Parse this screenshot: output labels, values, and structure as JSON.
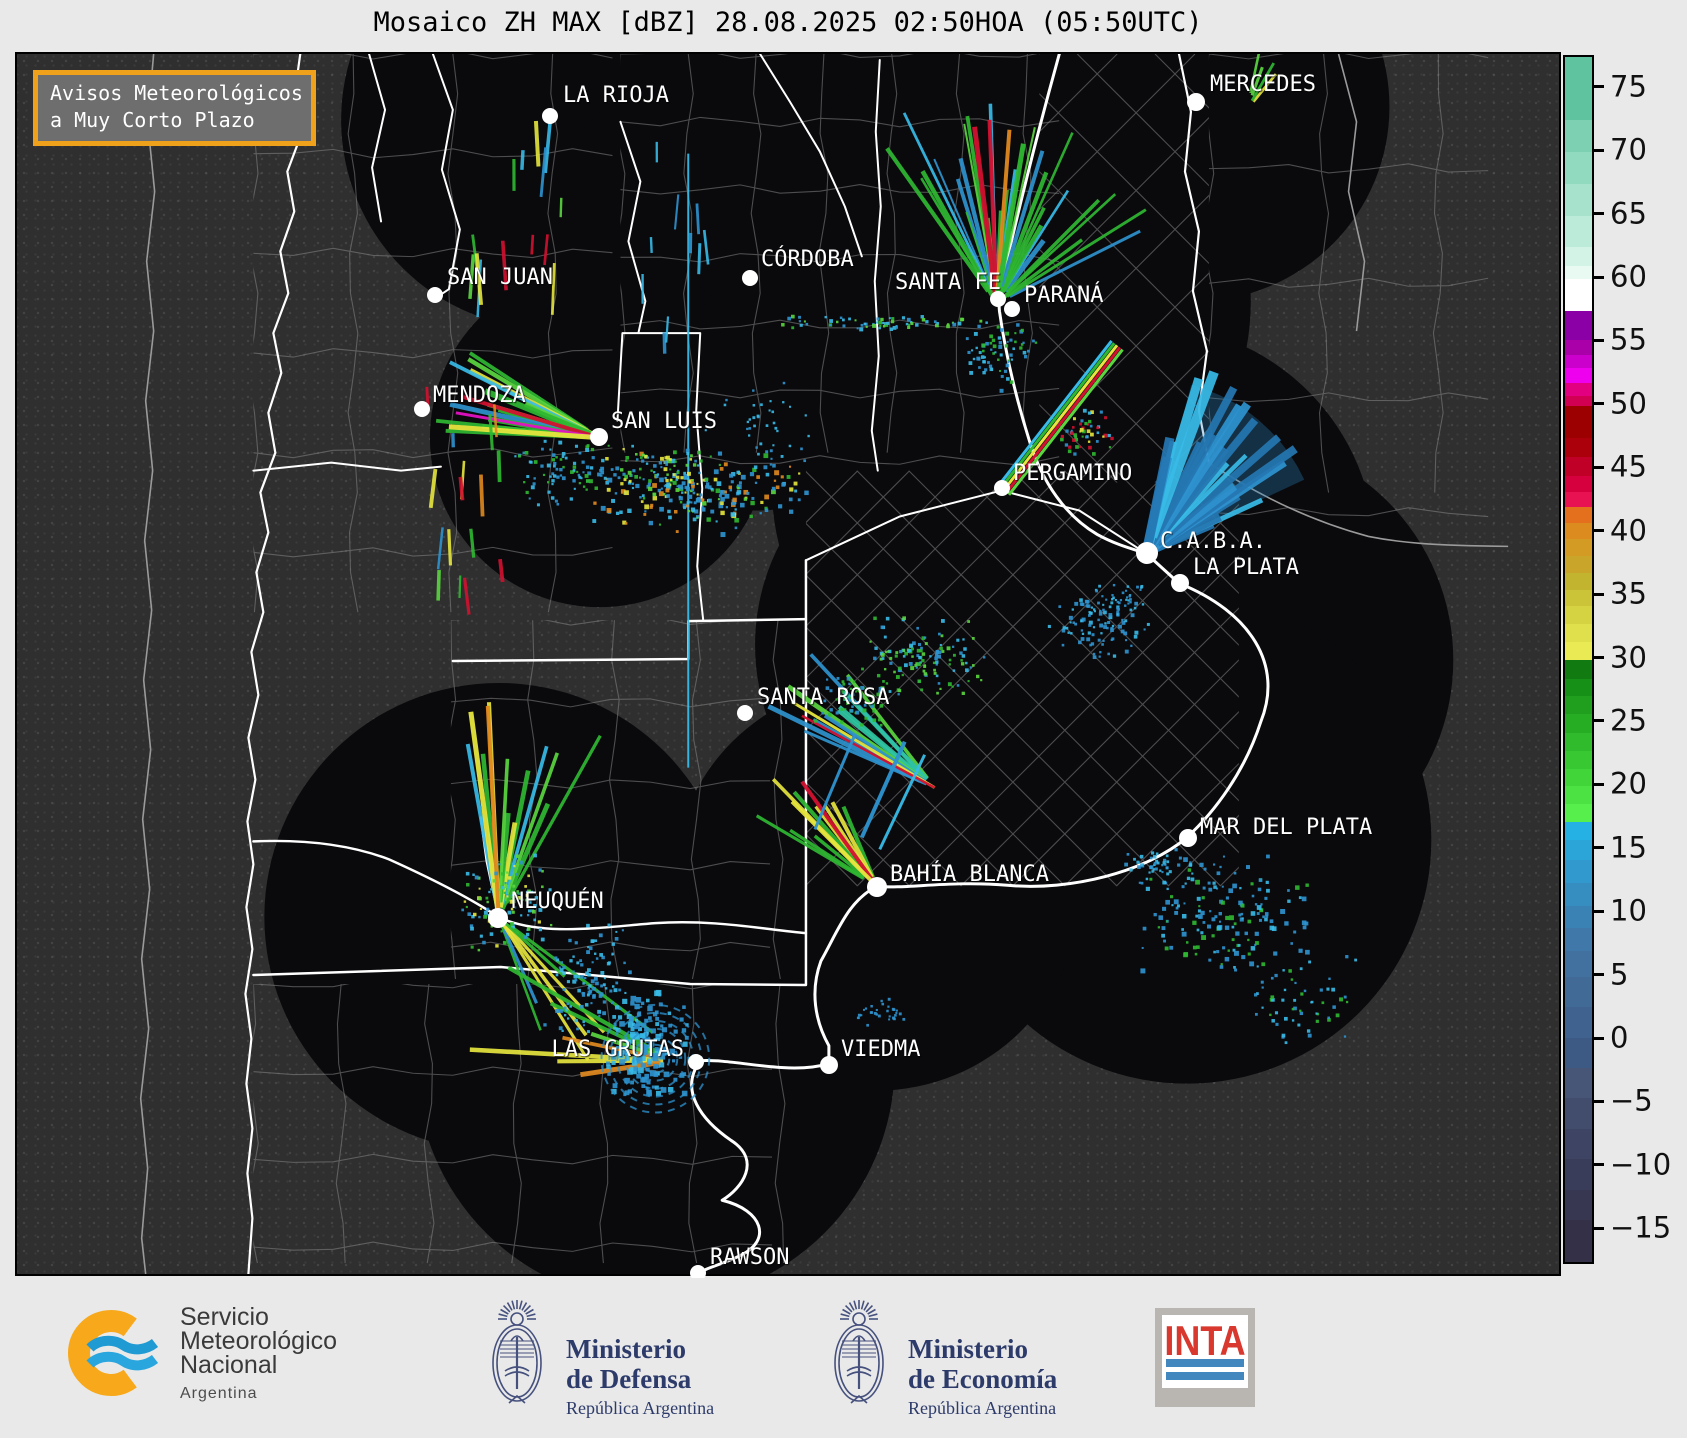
{
  "title": "Mosaico ZH MAX [dBZ] 28.08.2025 02:50HOA (05:50UTC)",
  "alert_box": {
    "line1": "Avisos Meteorológicos",
    "line2": "a Muy Corto Plazo"
  },
  "colors": {
    "accent_orange": "#f0a11c",
    "map_background": "#2f2f2f",
    "radar_coverage_dark": "#0a0a0d",
    "footer_navy": "#2d3b6a",
    "inta_red": "#d9382e",
    "inta_blue": "#4387bf",
    "smn_orange": "#f7a81b",
    "smn_blue": "#1f9ad2"
  },
  "map": {
    "cities": [
      {
        "name": "LA RIOJA",
        "dot": [
          550,
          116
        ],
        "label": [
          563,
          96
        ],
        "anchor": "start",
        "r": 8
      },
      {
        "name": "MERCEDES",
        "dot": [
          1196,
          102
        ],
        "label": [
          1210,
          85
        ],
        "anchor": "start",
        "r": 9
      },
      {
        "name": "SAN JUAN",
        "dot": [
          435,
          295
        ],
        "label": [
          447,
          278
        ],
        "anchor": "start",
        "r": 8
      },
      {
        "name": "CÓRDOBA",
        "dot": [
          750,
          278
        ],
        "label": [
          761,
          260
        ],
        "anchor": "start",
        "r": 8
      },
      {
        "name": "SANTA FE",
        "dot": [
          998,
          299
        ],
        "label": [
          1001,
          283
        ],
        "anchor": "end",
        "r": 8
      },
      {
        "name": "PARANÁ",
        "dot": [
          1012,
          309
        ],
        "label": [
          1024,
          296
        ],
        "anchor": "start",
        "r": 8
      },
      {
        "name": "MENDOZA",
        "dot": [
          422,
          409
        ],
        "label": [
          433,
          396
        ],
        "anchor": "start",
        "r": 8
      },
      {
        "name": "SAN LUIS",
        "dot": [
          599,
          437
        ],
        "label": [
          611,
          422
        ],
        "anchor": "start",
        "r": 9
      },
      {
        "name": "PERGAMINO",
        "dot": [
          1002,
          488
        ],
        "label": [
          1013,
          474
        ],
        "anchor": "start",
        "r": 8
      },
      {
        "name": "C.A.B.A.",
        "dot": [
          1147,
          553
        ],
        "label": [
          1160,
          542
        ],
        "anchor": "start",
        "r": 11
      },
      {
        "name": "LA PLATA",
        "dot": [
          1180,
          583
        ],
        "label": [
          1193,
          568
        ],
        "anchor": "start",
        "r": 9
      },
      {
        "name": "SANTA ROSA",
        "dot": [
          745,
          713
        ],
        "label": [
          757,
          698
        ],
        "anchor": "start",
        "r": 8
      },
      {
        "name": "MAR DEL PLATA",
        "dot": [
          1188,
          838
        ],
        "label": [
          1200,
          828
        ],
        "anchor": "start",
        "r": 9
      },
      {
        "name": "BAHÍA BLANCA",
        "dot": [
          877,
          887
        ],
        "label": [
          890,
          875
        ],
        "anchor": "start",
        "r": 10
      },
      {
        "name": "NEUQUÉN",
        "dot": [
          498,
          918
        ],
        "label": [
          511,
          902
        ],
        "anchor": "start",
        "r": 10
      },
      {
        "name": "LAS GRUTAS",
        "dot": [
          696,
          1062
        ],
        "label": [
          684,
          1050
        ],
        "anchor": "end",
        "r": 8
      },
      {
        "name": "VIEDMA",
        "dot": [
          829,
          1065
        ],
        "label": [
          841,
          1050
        ],
        "anchor": "start",
        "r": 9
      },
      {
        "name": "RAWSON",
        "dot": [
          698,
          1273
        ],
        "label": [
          710,
          1258
        ],
        "anchor": "start",
        "r": 8
      }
    ]
  },
  "colorbar": {
    "unit": "dBZ",
    "top_value": 77.5,
    "bottom_value": -17.5,
    "ticks": [
      75,
      70,
      65,
      60,
      55,
      50,
      45,
      40,
      35,
      30,
      25,
      20,
      15,
      10,
      5,
      0,
      -5,
      -10,
      -15
    ],
    "stops": [
      [
        77.5,
        "#60c3a0"
      ],
      [
        72.5,
        "#7dd1b2"
      ],
      [
        70,
        "#92dabf"
      ],
      [
        67.5,
        "#a7e3cc"
      ],
      [
        65,
        "#bcecd9"
      ],
      [
        62.5,
        "#d2f3e6"
      ],
      [
        61,
        "#e8faf2"
      ],
      [
        60,
        "#ffffff"
      ],
      [
        57.5,
        "#8a00a6"
      ],
      [
        55.2,
        "#aa00aa"
      ],
      [
        54,
        "#cc00cc"
      ],
      [
        53,
        "#ee00ee"
      ],
      [
        51.8,
        "#e20080"
      ],
      [
        50.8,
        "#d20052"
      ],
      [
        50,
        "#9c0000"
      ],
      [
        47.5,
        "#ab000c"
      ],
      [
        46,
        "#c00026"
      ],
      [
        44.5,
        "#d6003f"
      ],
      [
        43.2,
        "#e81253"
      ],
      [
        42,
        "#e4701d"
      ],
      [
        40.8,
        "#dc8b1f"
      ],
      [
        39.5,
        "#d39a24"
      ],
      [
        38.2,
        "#c9a62a"
      ],
      [
        36.8,
        "#c3b430"
      ],
      [
        35.5,
        "#cbc438"
      ],
      [
        34.2,
        "#d5d341"
      ],
      [
        32.8,
        "#dfe04b"
      ],
      [
        31.4,
        "#eaea54"
      ],
      [
        30,
        "#117a11"
      ],
      [
        28.5,
        "#179017"
      ],
      [
        27.1,
        "#1f9f1d"
      ],
      [
        25.7,
        "#27ad24"
      ],
      [
        24.2,
        "#2fbb2b"
      ],
      [
        22.8,
        "#38c832"
      ],
      [
        21.4,
        "#41d53a"
      ],
      [
        20,
        "#4ce243"
      ],
      [
        18.6,
        "#57ef4c"
      ],
      [
        17.2,
        "#25b1e3"
      ],
      [
        15.8,
        "#2ba5d8"
      ],
      [
        14.2,
        "#3199cd"
      ],
      [
        12.4,
        "#368dbf"
      ],
      [
        10.6,
        "#3a82b3"
      ],
      [
        8.8,
        "#3f78a9"
      ],
      [
        7,
        "#42719f"
      ],
      [
        5,
        "#426a97"
      ],
      [
        2.6,
        "#3f628e"
      ],
      [
        0.2,
        "#3d5a84"
      ],
      [
        -2.2,
        "#475677"
      ],
      [
        -4.6,
        "#424d6e"
      ],
      [
        -7,
        "#3e4564"
      ],
      [
        -9.4,
        "#3a3d5a"
      ],
      [
        -11.8,
        "#373751"
      ],
      [
        -14.2,
        "#333047"
      ]
    ]
  },
  "footer": {
    "smn": {
      "line1": "Servicio",
      "line2": "Meteorológico",
      "line3": "Nacional",
      "line4": "Argentina"
    },
    "defensa": {
      "line1": "Ministerio",
      "line2": "de Defensa",
      "line3": "República Argentina"
    },
    "economia": {
      "line1": "Ministerio",
      "line2": "de Economía",
      "line3": "República Argentina"
    },
    "inta": {
      "label": "INTA"
    }
  }
}
